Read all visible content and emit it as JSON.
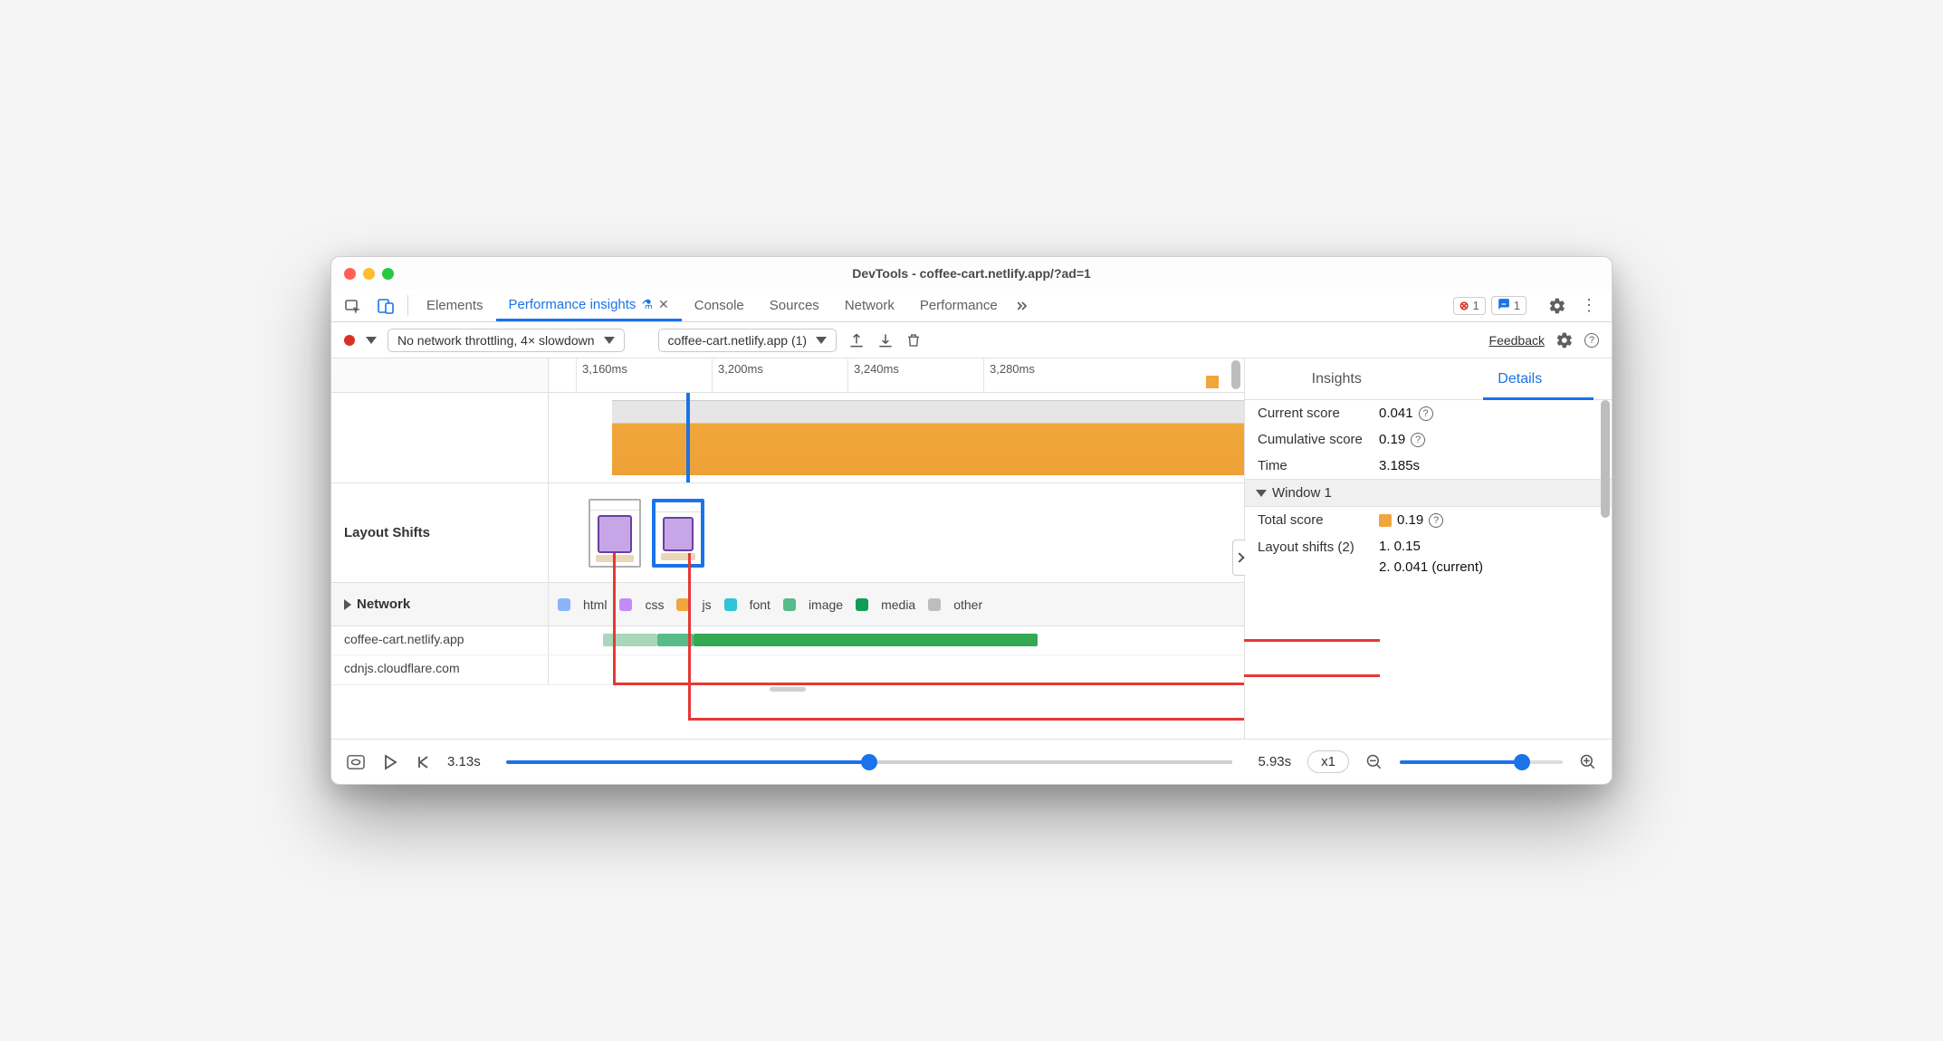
{
  "window": {
    "title": "DevTools - coffee-cart.netlify.app/?ad=1"
  },
  "badges": {
    "errors": "1",
    "messages": "1"
  },
  "tabs": {
    "elements": "Elements",
    "perf_insights": "Performance insights",
    "console": "Console",
    "sources": "Sources",
    "network": "Network",
    "performance": "Performance"
  },
  "toolbar": {
    "throttling": "No network throttling, 4× slowdown",
    "recording": "coffee-cart.netlify.app (1)",
    "feedback": "Feedback"
  },
  "ruler": {
    "t0": "3,160ms",
    "t1": "3,200ms",
    "t2": "3,240ms",
    "t3": "3,280ms"
  },
  "tracks": {
    "layout_shifts": "Layout Shifts",
    "network": "Network"
  },
  "legend": {
    "html": "html",
    "css": "css",
    "js": "js",
    "font": "font",
    "image": "image",
    "media": "media",
    "other": "other"
  },
  "colors": {
    "html": "#8ab4f8",
    "css": "#c58af9",
    "js": "#f0a63c",
    "font": "#2ec4d6",
    "image": "#57bb8a",
    "media": "#0f9d58",
    "other": "#bdbdbd"
  },
  "network_rows": {
    "r1": "coffee-cart.netlify.app",
    "r2": "cdnjs.cloudflare.com"
  },
  "sidebar": {
    "tab_insights": "Insights",
    "tab_details": "Details",
    "current_score_label": "Current score",
    "current_score_value": "0.041",
    "cumulative_score_label": "Cumulative score",
    "cumulative_score_value": "0.19",
    "time_label": "Time",
    "time_value": "3.185s",
    "window_header": "Window 1",
    "total_score_label": "Total score",
    "total_score_value": "0.19",
    "layout_shifts_label": "Layout shifts (2)",
    "ls1": "1. 0.15",
    "ls2": "2. 0.041 (current)"
  },
  "footer": {
    "start": "3.13s",
    "end": "5.93s",
    "speed": "x1"
  }
}
